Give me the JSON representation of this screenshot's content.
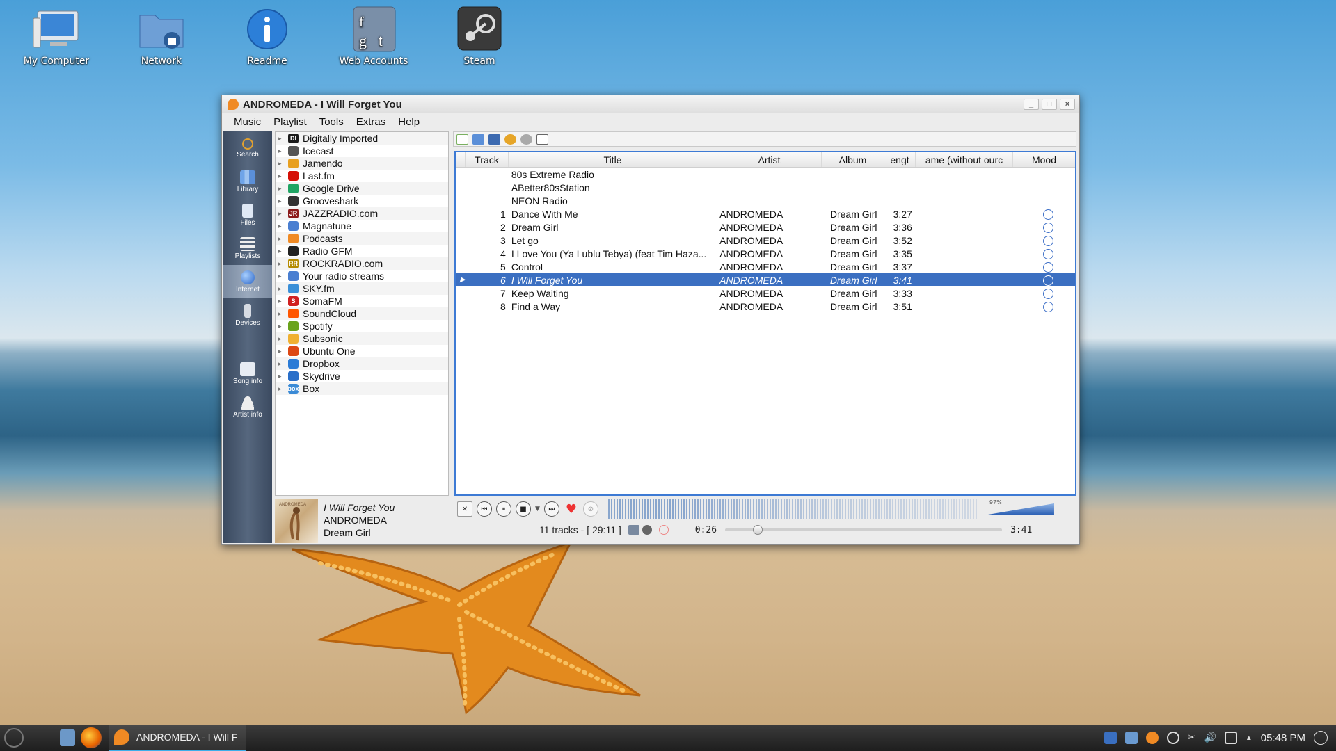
{
  "desktop": {
    "icons": [
      {
        "label": "My Computer",
        "icon": "computer-icon"
      },
      {
        "label": "Network",
        "icon": "network-folder-icon"
      },
      {
        "label": "Readme",
        "icon": "info-icon"
      },
      {
        "label": "Web Accounts",
        "icon": "web-accounts-icon"
      },
      {
        "label": "Steam",
        "icon": "steam-icon"
      }
    ]
  },
  "window": {
    "title": "ANDROMEDA - I Will Forget You",
    "controls": [
      "_",
      "□",
      "×"
    ],
    "menu": [
      "Music",
      "Playlist",
      "Tools",
      "Extras",
      "Help"
    ]
  },
  "sidebar": {
    "items": [
      {
        "label": "Search",
        "icon": "search-icon"
      },
      {
        "label": "Library",
        "icon": "library-icon"
      },
      {
        "label": "Files",
        "icon": "files-icon"
      },
      {
        "label": "Playlists",
        "icon": "playlists-icon"
      },
      {
        "label": "Internet",
        "icon": "globe-icon",
        "active": true
      },
      {
        "label": "Devices",
        "icon": "devices-icon"
      },
      {
        "label": "Song info",
        "icon": "song-info-icon"
      },
      {
        "label": "Artist info",
        "icon": "artist-info-icon"
      }
    ]
  },
  "internet_services": [
    {
      "label": "Digitally Imported",
      "badge": "DI",
      "color": "#1a1a1a"
    },
    {
      "label": "Icecast",
      "badge": "",
      "color": "#555555"
    },
    {
      "label": "Jamendo",
      "badge": "",
      "color": "#e8a020"
    },
    {
      "label": "Last.fm",
      "badge": "",
      "color": "#d51007"
    },
    {
      "label": "Google Drive",
      "badge": "",
      "color": "#1fa463"
    },
    {
      "label": "Grooveshark",
      "badge": "",
      "color": "#333333"
    },
    {
      "label": "JAZZRADIO.com",
      "badge": "JR",
      "color": "#8b1a1a"
    },
    {
      "label": "Magnatune",
      "badge": "",
      "color": "#4a7fd1"
    },
    {
      "label": "Podcasts",
      "badge": "",
      "color": "#f08a24"
    },
    {
      "label": "Radio GFM",
      "badge": "",
      "color": "#222222"
    },
    {
      "label": "ROCKRADIO.com",
      "badge": "RR",
      "color": "#b58b00"
    },
    {
      "label": "Your radio streams",
      "badge": "",
      "color": "#4a7fd1"
    },
    {
      "label": "SKY.fm",
      "badge": "",
      "color": "#3a8fd8"
    },
    {
      "label": "SomaFM",
      "badge": "S",
      "color": "#d02020"
    },
    {
      "label": "SoundCloud",
      "badge": "",
      "color": "#ff5500"
    },
    {
      "label": "Spotify",
      "badge": "",
      "color": "#6aa31c"
    },
    {
      "label": "Subsonic",
      "badge": "",
      "color": "#f0b030"
    },
    {
      "label": "Ubuntu One",
      "badge": "",
      "color": "#dd4814"
    },
    {
      "label": "Dropbox",
      "badge": "",
      "color": "#2b7bd6"
    },
    {
      "label": "Skydrive",
      "badge": "",
      "color": "#2a6fc9"
    },
    {
      "label": "Box",
      "badge": "box",
      "color": "#3a8ad6"
    }
  ],
  "now_playing": {
    "title": "I Will Forget You",
    "artist": "ANDROMEDA",
    "album": "Dream Girl"
  },
  "playlist": {
    "columns": [
      "Track",
      "Title",
      "Artist",
      "Album",
      "engt",
      "ame (without  ourc",
      "Mood"
    ],
    "rows": [
      {
        "track": "",
        "title": "80s Extreme Radio",
        "artist": "",
        "album": "",
        "length": "",
        "mood": false,
        "playing": false
      },
      {
        "track": "",
        "title": "ABetter80sStation",
        "artist": "",
        "album": "",
        "length": "",
        "mood": false,
        "playing": false
      },
      {
        "track": "",
        "title": "NEON Radio",
        "artist": "",
        "album": "",
        "length": "",
        "mood": false,
        "playing": false
      },
      {
        "track": "1",
        "title": "Dance With Me",
        "artist": "ANDROMEDA",
        "album": "Dream Girl",
        "length": "3:27",
        "mood": true,
        "playing": false
      },
      {
        "track": "2",
        "title": "Dream Girl",
        "artist": "ANDROMEDA",
        "album": "Dream Girl",
        "length": "3:36",
        "mood": true,
        "playing": false
      },
      {
        "track": "3",
        "title": "Let go",
        "artist": "ANDROMEDA",
        "album": "Dream Girl",
        "length": "3:52",
        "mood": true,
        "playing": false
      },
      {
        "track": "4",
        "title": "I Love You (Ya Lublu Tebya) (feat Tim Haza...",
        "artist": "ANDROMEDA",
        "album": "Dream Girl",
        "length": "3:35",
        "mood": true,
        "playing": false
      },
      {
        "track": "5",
        "title": "Control",
        "artist": "ANDROMEDA",
        "album": "Dream Girl",
        "length": "3:37",
        "mood": true,
        "playing": false
      },
      {
        "track": "6",
        "title": "I Will Forget You",
        "artist": "ANDROMEDA",
        "album": "Dream Girl",
        "length": "3:41",
        "mood": true,
        "playing": true
      },
      {
        "track": "7",
        "title": "Keep Waiting",
        "artist": "ANDROMEDA",
        "album": "Dream Girl",
        "length": "3:33",
        "mood": true,
        "playing": false
      },
      {
        "track": "8",
        "title": "Find a Way",
        "artist": "ANDROMEDA",
        "album": "Dream Girl",
        "length": "3:51",
        "mood": true,
        "playing": false
      }
    ]
  },
  "player": {
    "volume_label": "97%",
    "volume_fraction": 0.97,
    "summary": "11 tracks - [ 29:11 ]",
    "elapsed": "0:26",
    "total": "3:41",
    "progress_fraction": 0.118
  },
  "taskbar": {
    "active_task": "ANDROMEDA - I Will F",
    "clock": "05:48 PM"
  },
  "colors": {
    "selection": "#3b6fc1",
    "accent": "#3d7ad4",
    "sidebar": "#46566d"
  }
}
